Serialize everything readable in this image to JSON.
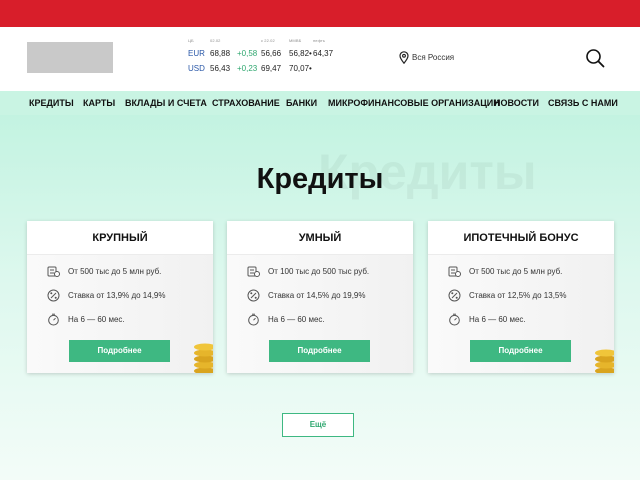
{
  "header": {
    "location": "Вся Россия"
  },
  "rates": {
    "headers": [
      "ЦБ",
      "02.02",
      "с 22.02",
      "ММВБ",
      "нефть"
    ],
    "rows": [
      {
        "currency": "EUR",
        "cb": "68,88",
        "change": "+0,58",
        "v1": "56,66",
        "v2": "56,82",
        "v2_suffix": "•",
        "v3": "64,37"
      },
      {
        "currency": "USD",
        "cb": "56,43",
        "change": "+0,23",
        "v1": "69,47",
        "v2": "70,07",
        "v2_suffix": "•",
        "v3": ""
      }
    ]
  },
  "nav": {
    "items": [
      "КРЕДИТЫ",
      "КАРТЫ",
      "ВКЛАДЫ И СЧЕТА",
      "СТРАХОВАНИЕ",
      "БАНКИ",
      "МИКРОФИНАНСОВЫЕ ОРГАНИЗАЦИИ",
      "НОВОСТИ",
      "СВЯЗЬ С НАМИ"
    ]
  },
  "page": {
    "title": "Кредиты",
    "ghost_title": "Кредиты"
  },
  "cards": [
    {
      "title": "КРУПНЫЙ",
      "amount": "От 500 тыс до 5 млн руб.",
      "rate": "Ставка от 13,9% до 14,9%",
      "term": "На 6 — 60 мес.",
      "button": "Подробнее"
    },
    {
      "title": "УМНЫЙ",
      "amount": "От 100 тыс до 500 тыс руб.",
      "rate": "Ставка от 14,5% до 19,9%",
      "term": "На 6 — 60 мес.",
      "button": "Подробнее"
    },
    {
      "title": "ИПОТЕЧНЫЙ БОНУС",
      "amount": "От 500 тыс до 5 млн руб.",
      "rate": "Ставка от 12,5% до 13,5%",
      "term": "На 6 — 60 мес.",
      "button": "Подробнее"
    }
  ],
  "more_button": "Ещё",
  "colors": {
    "top_bar": "#d81e2a",
    "nav_background": "#c9f4e3",
    "accent_green": "#3eb882",
    "currency_blue": "#2a58a8"
  },
  "icons": [
    "location-pin-icon",
    "search-icon",
    "money-stack-icon",
    "percent-icon",
    "stopwatch-icon",
    "coins-icon"
  ]
}
